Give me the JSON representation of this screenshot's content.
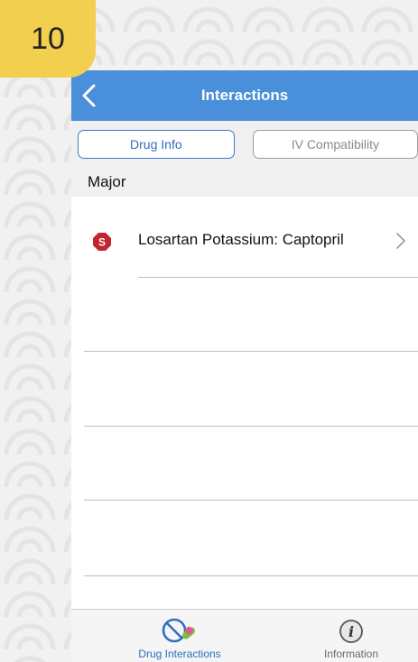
{
  "badge": "10",
  "nav": {
    "title": "Interactions",
    "back_icon": "chevron-left-icon"
  },
  "segments": [
    {
      "label": "Drug Info",
      "active": true
    },
    {
      "label": "IV Compatibility",
      "active": false
    }
  ],
  "section": {
    "title": "Major"
  },
  "interactions": [
    {
      "severity_icon": "stop-sign-icon",
      "severity_letter": "S",
      "label": "Losartan Potassium: Captopril"
    }
  ],
  "tabbar": {
    "items": [
      {
        "label": "Drug Interactions",
        "icon": "drug-interactions-icon",
        "active": true
      },
      {
        "label": "Information",
        "icon": "info-icon",
        "active": false
      }
    ]
  },
  "colors": {
    "nav_bg": "#4a8fd9",
    "accent": "#2f6fbe",
    "badge_bg": "#f2cf4f",
    "stop_sign": "#c0262d"
  }
}
